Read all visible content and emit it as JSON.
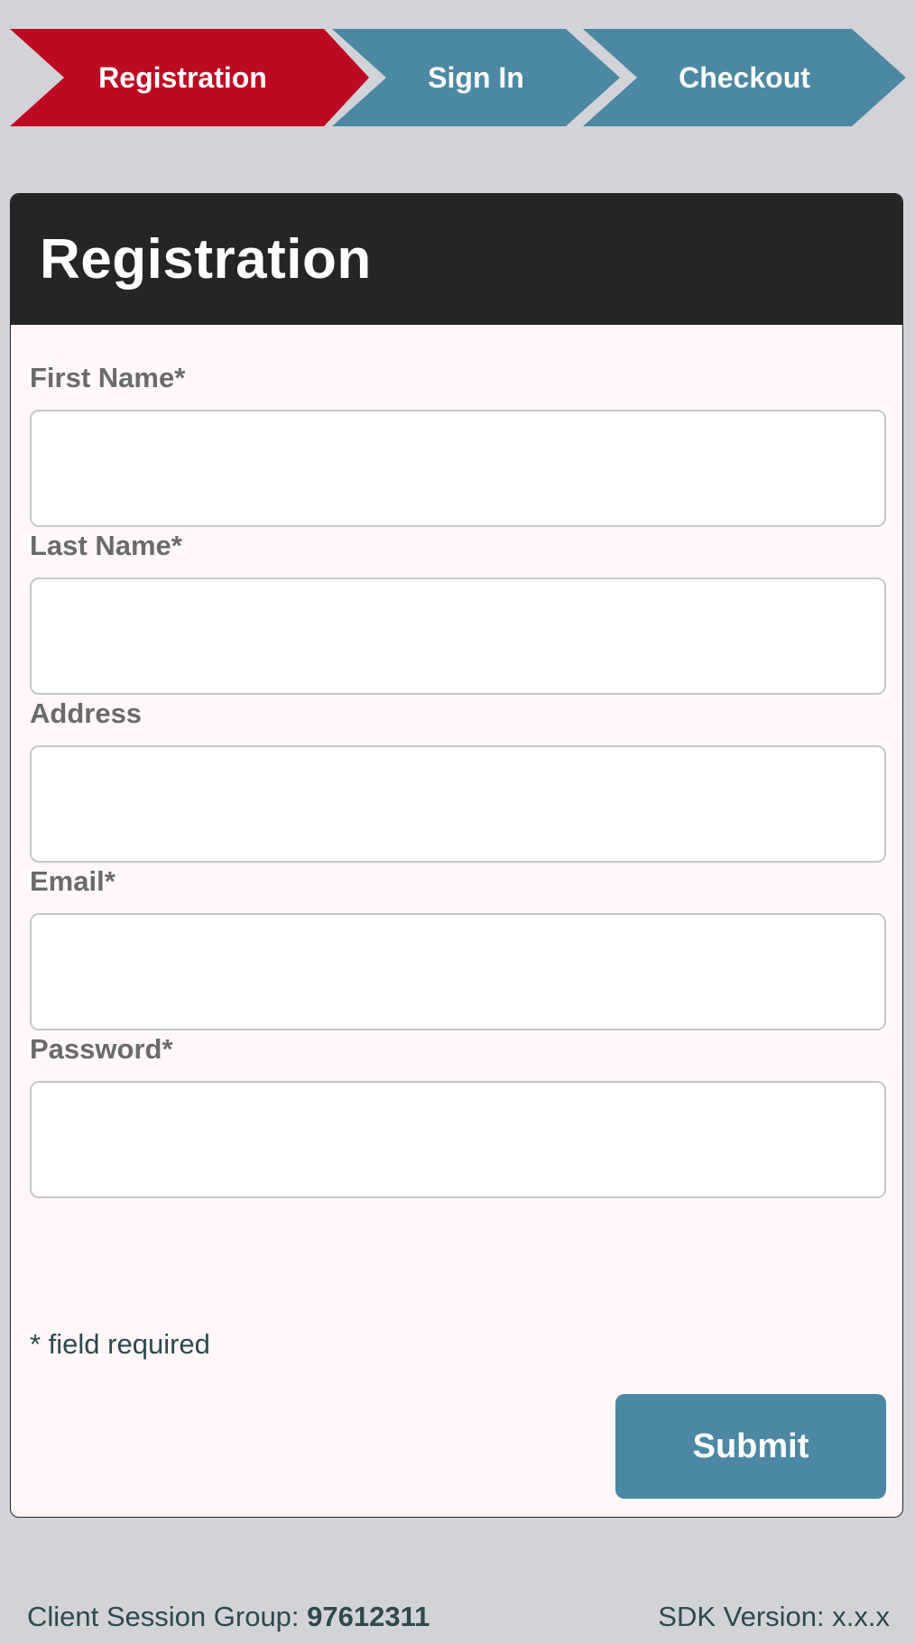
{
  "steps": [
    {
      "label": "Registration",
      "state": "active",
      "color": "#bd0a22"
    },
    {
      "label": "Sign In",
      "state": "inactive",
      "color": "#4c88a3"
    },
    {
      "label": "Checkout",
      "state": "inactive",
      "color": "#4c88a3"
    }
  ],
  "form": {
    "title": "Registration",
    "fields": [
      {
        "label": "First Name*",
        "value": "",
        "placeholder": ""
      },
      {
        "label": "Last Name*",
        "value": "",
        "placeholder": ""
      },
      {
        "label": "Address",
        "value": "",
        "placeholder": ""
      },
      {
        "label": "Email*",
        "value": "",
        "placeholder": ""
      },
      {
        "label": "Password*",
        "value": "",
        "placeholder": ""
      }
    ],
    "required_note": "* field required",
    "submit_label": "Submit"
  },
  "footer": {
    "session_label": "Client Session Group:",
    "session_value": "97612311",
    "sdk_label": "SDK Version: x.x.x"
  },
  "colors": {
    "accent_red": "#bd0a22",
    "accent_blue": "#4c88a3",
    "header_dark": "#232527",
    "page_bg": "#d2d3d8"
  }
}
